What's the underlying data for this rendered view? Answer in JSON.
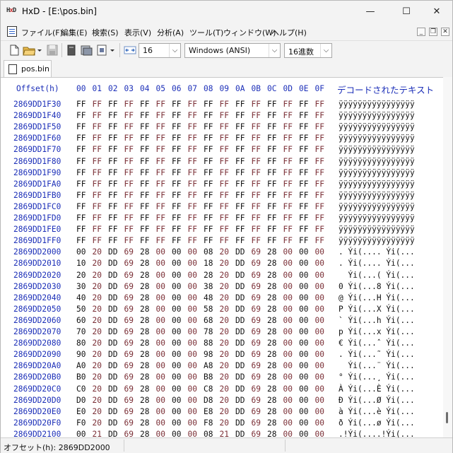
{
  "window": {
    "title": "HxD - [E:\\pos.bin]",
    "controls": {
      "minimize": "—",
      "maximize": "☐",
      "close": "✕"
    }
  },
  "menu": {
    "items": [
      "ファイル(F)",
      "編集(E)",
      "検索(S)",
      "表示(V)",
      "分析(A)",
      "ツール(T)",
      "ウィンドウ(W)",
      "ヘルプ(H)"
    ],
    "mdi": {
      "minimize": "_",
      "restore": "❐",
      "close": "✕"
    }
  },
  "toolbar": {
    "bytes_per_row": "16",
    "charset": "Windows (ANSI)",
    "offset_base": "16進数"
  },
  "tabs": [
    {
      "label": "pos.bin"
    }
  ],
  "hexview": {
    "offset_header": "Offset(h)",
    "columns": [
      "00",
      "01",
      "02",
      "03",
      "04",
      "05",
      "06",
      "07",
      "08",
      "09",
      "0A",
      "0B",
      "0C",
      "0D",
      "0E",
      "0F"
    ],
    "decoded_header": "デコードされたテキスト",
    "rows": [
      {
        "offset": "2869DD1F30",
        "bytes": [
          "FF",
          "FF",
          "FF",
          "FF",
          "FF",
          "FF",
          "FF",
          "FF",
          "FF",
          "FF",
          "FF",
          "FF",
          "FF",
          "FF",
          "FF",
          "FF"
        ],
        "text": "ÿÿÿÿÿÿÿÿÿÿÿÿÿÿÿÿ"
      },
      {
        "offset": "2869DD1F40",
        "bytes": [
          "FF",
          "FF",
          "FF",
          "FF",
          "FF",
          "FF",
          "FF",
          "FF",
          "FF",
          "FF",
          "FF",
          "FF",
          "FF",
          "FF",
          "FF",
          "FF"
        ],
        "text": "ÿÿÿÿÿÿÿÿÿÿÿÿÿÿÿÿ"
      },
      {
        "offset": "2869DD1F50",
        "bytes": [
          "FF",
          "FF",
          "FF",
          "FF",
          "FF",
          "FF",
          "FF",
          "FF",
          "FF",
          "FF",
          "FF",
          "FF",
          "FF",
          "FF",
          "FF",
          "FF"
        ],
        "text": "ÿÿÿÿÿÿÿÿÿÿÿÿÿÿÿÿ"
      },
      {
        "offset": "2869DD1F60",
        "bytes": [
          "FF",
          "FF",
          "FF",
          "FF",
          "FF",
          "FF",
          "FF",
          "FF",
          "FF",
          "FF",
          "FF",
          "FF",
          "FF",
          "FF",
          "FF",
          "FF"
        ],
        "text": "ÿÿÿÿÿÿÿÿÿÿÿÿÿÿÿÿ"
      },
      {
        "offset": "2869DD1F70",
        "bytes": [
          "FF",
          "FF",
          "FF",
          "FF",
          "FF",
          "FF",
          "FF",
          "FF",
          "FF",
          "FF",
          "FF",
          "FF",
          "FF",
          "FF",
          "FF",
          "FF"
        ],
        "text": "ÿÿÿÿÿÿÿÿÿÿÿÿÿÿÿÿ"
      },
      {
        "offset": "2869DD1F80",
        "bytes": [
          "FF",
          "FF",
          "FF",
          "FF",
          "FF",
          "FF",
          "FF",
          "FF",
          "FF",
          "FF",
          "FF",
          "FF",
          "FF",
          "FF",
          "FF",
          "FF"
        ],
        "text": "ÿÿÿÿÿÿÿÿÿÿÿÿÿÿÿÿ"
      },
      {
        "offset": "2869DD1F90",
        "bytes": [
          "FF",
          "FF",
          "FF",
          "FF",
          "FF",
          "FF",
          "FF",
          "FF",
          "FF",
          "FF",
          "FF",
          "FF",
          "FF",
          "FF",
          "FF",
          "FF"
        ],
        "text": "ÿÿÿÿÿÿÿÿÿÿÿÿÿÿÿÿ"
      },
      {
        "offset": "2869DD1FA0",
        "bytes": [
          "FF",
          "FF",
          "FF",
          "FF",
          "FF",
          "FF",
          "FF",
          "FF",
          "FF",
          "FF",
          "FF",
          "FF",
          "FF",
          "FF",
          "FF",
          "FF"
        ],
        "text": "ÿÿÿÿÿÿÿÿÿÿÿÿÿÿÿÿ"
      },
      {
        "offset": "2869DD1FB0",
        "bytes": [
          "FF",
          "FF",
          "FF",
          "FF",
          "FF",
          "FF",
          "FF",
          "FF",
          "FF",
          "FF",
          "FF",
          "FF",
          "FF",
          "FF",
          "FF",
          "FF"
        ],
        "text": "ÿÿÿÿÿÿÿÿÿÿÿÿÿÿÿÿ"
      },
      {
        "offset": "2869DD1FC0",
        "bytes": [
          "FF",
          "FF",
          "FF",
          "FF",
          "FF",
          "FF",
          "FF",
          "FF",
          "FF",
          "FF",
          "FF",
          "FF",
          "FF",
          "FF",
          "FF",
          "FF"
        ],
        "text": "ÿÿÿÿÿÿÿÿÿÿÿÿÿÿÿÿ"
      },
      {
        "offset": "2869DD1FD0",
        "bytes": [
          "FF",
          "FF",
          "FF",
          "FF",
          "FF",
          "FF",
          "FF",
          "FF",
          "FF",
          "FF",
          "FF",
          "FF",
          "FF",
          "FF",
          "FF",
          "FF"
        ],
        "text": "ÿÿÿÿÿÿÿÿÿÿÿÿÿÿÿÿ"
      },
      {
        "offset": "2869DD1FE0",
        "bytes": [
          "FF",
          "FF",
          "FF",
          "FF",
          "FF",
          "FF",
          "FF",
          "FF",
          "FF",
          "FF",
          "FF",
          "FF",
          "FF",
          "FF",
          "FF",
          "FF"
        ],
        "text": "ÿÿÿÿÿÿÿÿÿÿÿÿÿÿÿÿ"
      },
      {
        "offset": "2869DD1FF0",
        "bytes": [
          "FF",
          "FF",
          "FF",
          "FF",
          "FF",
          "FF",
          "FF",
          "FF",
          "FF",
          "FF",
          "FF",
          "FF",
          "FF",
          "FF",
          "FF",
          "FF"
        ],
        "text": "ÿÿÿÿÿÿÿÿÿÿÿÿÿÿÿÿ"
      },
      {
        "offset": "2869DD2000",
        "bytes": [
          "00",
          "20",
          "DD",
          "69",
          "28",
          "00",
          "00",
          "00",
          "08",
          "20",
          "DD",
          "69",
          "28",
          "00",
          "00",
          "00"
        ],
        "text": ". Ýi(.... Ýi(..."
      },
      {
        "offset": "2869DD2010",
        "bytes": [
          "10",
          "20",
          "DD",
          "69",
          "28",
          "00",
          "00",
          "00",
          "18",
          "20",
          "DD",
          "69",
          "28",
          "00",
          "00",
          "00"
        ],
        "text": ". Ýi(.... Ýi(..."
      },
      {
        "offset": "2869DD2020",
        "bytes": [
          "20",
          "20",
          "DD",
          "69",
          "28",
          "00",
          "00",
          "00",
          "28",
          "20",
          "DD",
          "69",
          "28",
          "00",
          "00",
          "00"
        ],
        "text": "  Ýi(...( Ýi(..."
      },
      {
        "offset": "2869DD2030",
        "bytes": [
          "30",
          "20",
          "DD",
          "69",
          "28",
          "00",
          "00",
          "00",
          "38",
          "20",
          "DD",
          "69",
          "28",
          "00",
          "00",
          "00"
        ],
        "text": "0 Ýi(...8 Ýi(..."
      },
      {
        "offset": "2869DD2040",
        "bytes": [
          "40",
          "20",
          "DD",
          "69",
          "28",
          "00",
          "00",
          "00",
          "48",
          "20",
          "DD",
          "69",
          "28",
          "00",
          "00",
          "00"
        ],
        "text": "@ Ýi(...H Ýi(..."
      },
      {
        "offset": "2869DD2050",
        "bytes": [
          "50",
          "20",
          "DD",
          "69",
          "28",
          "00",
          "00",
          "00",
          "58",
          "20",
          "DD",
          "69",
          "28",
          "00",
          "00",
          "00"
        ],
        "text": "P Ýi(...X Ýi(..."
      },
      {
        "offset": "2869DD2060",
        "bytes": [
          "60",
          "20",
          "DD",
          "69",
          "28",
          "00",
          "00",
          "00",
          "68",
          "20",
          "DD",
          "69",
          "28",
          "00",
          "00",
          "00"
        ],
        "text": "` Ýi(...h Ýi(..."
      },
      {
        "offset": "2869DD2070",
        "bytes": [
          "70",
          "20",
          "DD",
          "69",
          "28",
          "00",
          "00",
          "00",
          "78",
          "20",
          "DD",
          "69",
          "28",
          "00",
          "00",
          "00"
        ],
        "text": "p Ýi(...x Ýi(..."
      },
      {
        "offset": "2869DD2080",
        "bytes": [
          "80",
          "20",
          "DD",
          "69",
          "28",
          "00",
          "00",
          "00",
          "88",
          "20",
          "DD",
          "69",
          "28",
          "00",
          "00",
          "00"
        ],
        "text": "€ Ýi(...ˆ Ýi(..."
      },
      {
        "offset": "2869DD2090",
        "bytes": [
          "90",
          "20",
          "DD",
          "69",
          "28",
          "00",
          "00",
          "00",
          "98",
          "20",
          "DD",
          "69",
          "28",
          "00",
          "00",
          "00"
        ],
        "text": ". Ýi(...˜ Ýi(..."
      },
      {
        "offset": "2869DD20A0",
        "bytes": [
          "A0",
          "20",
          "DD",
          "69",
          "28",
          "00",
          "00",
          "00",
          "A8",
          "20",
          "DD",
          "69",
          "28",
          "00",
          "00",
          "00"
        ],
        "text": "  Ýi(...¨ Ýi(..."
      },
      {
        "offset": "2869DD20B0",
        "bytes": [
          "B0",
          "20",
          "DD",
          "69",
          "28",
          "00",
          "00",
          "00",
          "B8",
          "20",
          "DD",
          "69",
          "28",
          "00",
          "00",
          "00"
        ],
        "text": "° Ýi(...¸ Ýi(..."
      },
      {
        "offset": "2869DD20C0",
        "bytes": [
          "C0",
          "20",
          "DD",
          "69",
          "28",
          "00",
          "00",
          "00",
          "C8",
          "20",
          "DD",
          "69",
          "28",
          "00",
          "00",
          "00"
        ],
        "text": "À Ýi(...È Ýi(..."
      },
      {
        "offset": "2869DD20D0",
        "bytes": [
          "D0",
          "20",
          "DD",
          "69",
          "28",
          "00",
          "00",
          "00",
          "D8",
          "20",
          "DD",
          "69",
          "28",
          "00",
          "00",
          "00"
        ],
        "text": "Ð Ýi(...Ø Ýi(..."
      },
      {
        "offset": "2869DD20E0",
        "bytes": [
          "E0",
          "20",
          "DD",
          "69",
          "28",
          "00",
          "00",
          "00",
          "E8",
          "20",
          "DD",
          "69",
          "28",
          "00",
          "00",
          "00"
        ],
        "text": "à Ýi(...è Ýi(..."
      },
      {
        "offset": "2869DD20F0",
        "bytes": [
          "F0",
          "20",
          "DD",
          "69",
          "28",
          "00",
          "00",
          "00",
          "F8",
          "20",
          "DD",
          "69",
          "28",
          "00",
          "00",
          "00"
        ],
        "text": "ð Ýi(...ø Ýi(..."
      },
      {
        "offset": "2869DD2100",
        "bytes": [
          "00",
          "21",
          "DD",
          "69",
          "28",
          "00",
          "00",
          "00",
          "08",
          "21",
          "DD",
          "69",
          "28",
          "00",
          "00",
          "00"
        ],
        "text": ".!Ýi(....!Ýi(..."
      }
    ]
  },
  "statusbar": {
    "offset_text": "オフセット(h): 2869DD2000"
  },
  "colors": {
    "offset_blue": "#1c2fb8",
    "odd_byte": "#7a2e35",
    "background": "#ffffff"
  }
}
